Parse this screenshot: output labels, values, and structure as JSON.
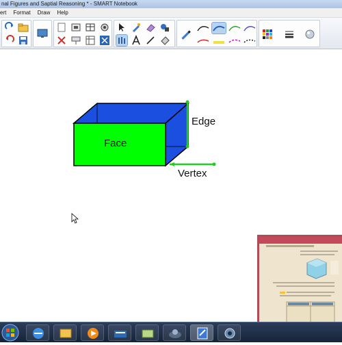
{
  "window": {
    "title": "nal Figures and Saptial Reasoning * - SMART Notebook"
  },
  "menu": {
    "items": [
      "ert",
      "Format",
      "Draw",
      "Help"
    ]
  },
  "toolbar": {
    "icons": [
      "redo-icon",
      "open-file-icon",
      "undo-icon",
      "save-icon",
      "screen-display-icon",
      "page-icon",
      "capture-icon",
      "table-icon",
      "document-camera-icon",
      "delete-icon",
      "screen-shade-icon",
      "table-grid-icon",
      "full-screen-icon",
      "select-icon",
      "pen-icon",
      "eraser-icon",
      "shapes-icon",
      "magic-pen-icon",
      "text-icon",
      "line-icon",
      "fill-icon",
      "highlighter-icon",
      "line-style-1-icon",
      "line-style-2-icon",
      "line-style-3-icon",
      "line-style-4-icon",
      "line-style-5-icon",
      "line-style-6-icon",
      "line-style-7-icon",
      "line-style-8-icon",
      "color-palette-icon",
      "line-properties-icon",
      "fill-effects-icon"
    ],
    "accent": "#7fa8d8"
  },
  "canvas": {
    "face_label": "Face",
    "edge_label": "Edge",
    "vertex_label": "Vertex",
    "colors": {
      "face": "#00ff00",
      "top": "#1a4fe0",
      "side": "#1a4fe0",
      "edge_marker": "#22cc22",
      "outline": "#000000"
    }
  },
  "webcam": {
    "description_text": ""
  },
  "taskbar": {
    "icons": [
      "start-orb-icon",
      "internet-explorer-icon",
      "file-explorer-icon",
      "media-player-icon",
      "smart-tools-icon",
      "folder-icon",
      "smart-board-icon",
      "smart-notebook-icon",
      "camera-icon",
      "webcam-app-icon"
    ]
  }
}
